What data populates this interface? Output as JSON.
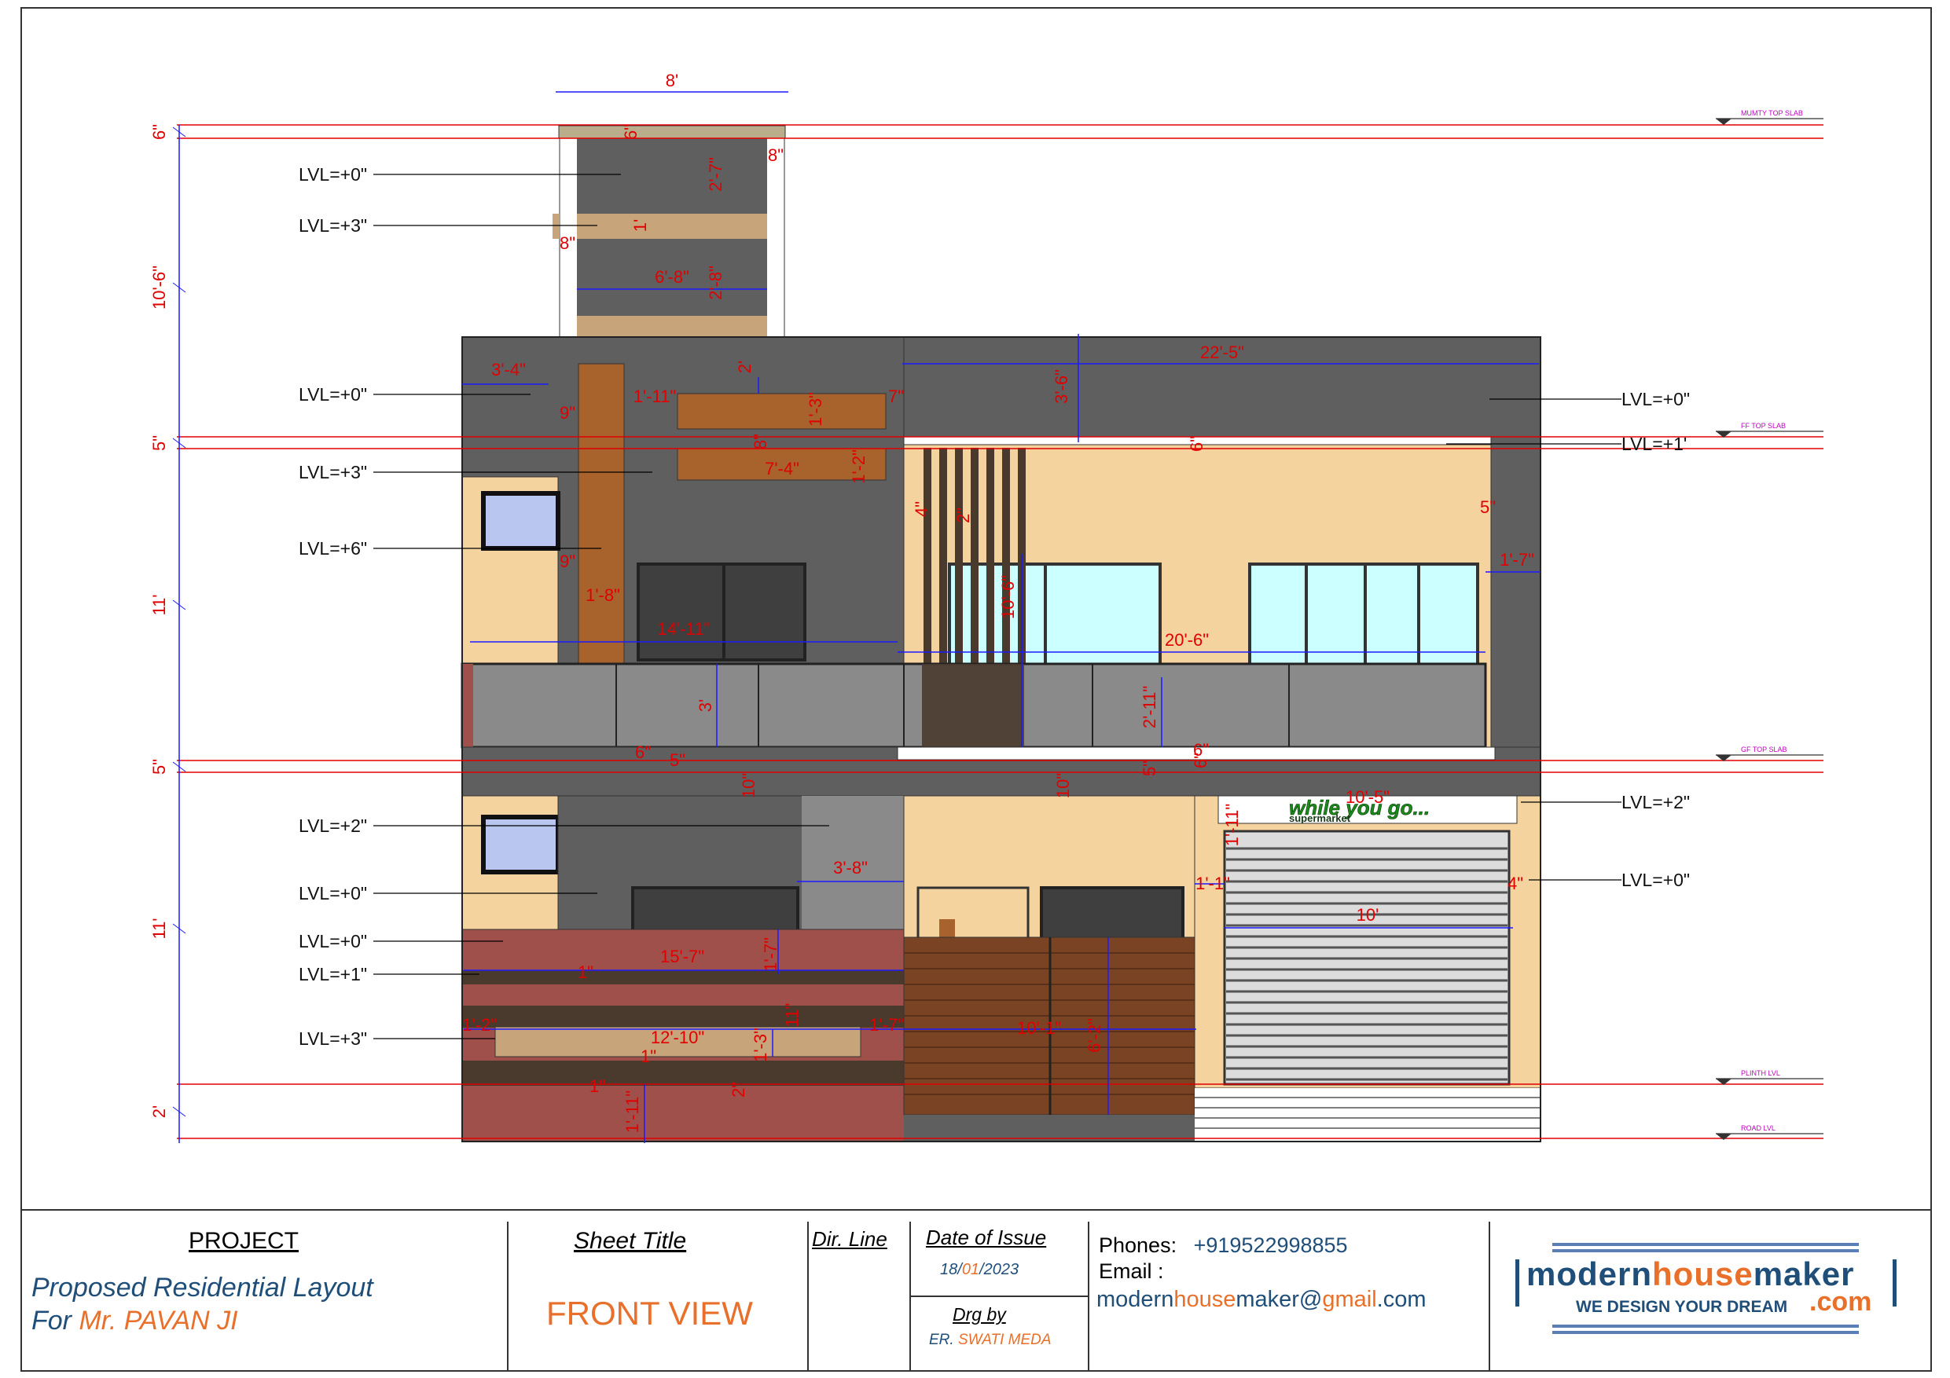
{
  "levels": {
    "right_ticks": [
      "MUMTY TOP SLAB",
      "FF TOP SLAB",
      "GF TOP SLAB",
      "PLINTH LVL",
      "ROAD LVL"
    ]
  },
  "left_callouts": [
    "LVL=+0\"",
    "LVL=+3\"",
    "LVL=+0\"",
    "LVL=+3\"",
    "LVL=+6\"",
    "LVL=+2\"",
    "LVL=+0\"",
    "LVL=+0\"",
    "LVL=+1\"",
    "LVL=+3\""
  ],
  "right_callouts": [
    "LVL=+0\"",
    "LVL=+1'",
    "LVL=+2\"",
    "LVL=+0\""
  ],
  "vertical_dims": [
    "6\"",
    "10'-6\"",
    "5\"",
    "11'",
    "5\"",
    "11'",
    "2'"
  ],
  "mumty_dims": [
    "8'",
    "6\"",
    "2'-7\"",
    "8\"",
    "1'",
    "8\"",
    "6'-8\"",
    "2'-8\""
  ],
  "ff_dims": [
    "3'-4\"",
    "9\"",
    "1'-11\"",
    "7\"",
    "2'",
    "1'-3\"",
    "8\"",
    "7'-4\"",
    "1'-2\"",
    "9\"",
    "1'-8\"",
    "14'-11\"",
    "3'",
    "6\"",
    "5\"",
    "22'-5\"",
    "3'-6\"",
    "6\"",
    "5\"",
    "1'-7\"",
    "4\"",
    "2\"",
    "10'-6\"",
    "20'-6\"",
    "2'-11\"",
    "6\"",
    "6\""
  ],
  "gf_dims": [
    "10\"",
    "10\"",
    "5\"",
    "3'-8\"",
    "1'-11\"",
    "10'-5\"",
    "1'-1\"",
    "4\"",
    "10'",
    "15'-7\"",
    "1'-7\"",
    "1\"",
    "1'-2\"",
    "12'-10\"",
    "1'-3\"",
    "11\"",
    "1'-7\"",
    "10'-1\"",
    "6'-2\"",
    "1\"",
    "1\"",
    "2\"",
    "1'-11\""
  ],
  "shop_sign": {
    "main": "while you go...",
    "sub": "supermarket"
  },
  "title_block": {
    "project_label": "PROJECT",
    "project_line1": "Proposed Residential Layout",
    "project_for": "For",
    "client": "Mr. PAVAN JI",
    "sheet_title_label": "Sheet Title",
    "sheet_title": "FRONT VIEW",
    "dir_line_label": "Dir. Line",
    "date_label": "Date of Issue",
    "date_day": "18/",
    "date_month": "01",
    "date_year": "/2023",
    "drawn_by_label": "Drg by",
    "drawn_by_prefix": "ER.",
    "drawn_by_name": "SWATI MEDA",
    "phones_label": "Phones:",
    "phone": "+919522998855",
    "email_label": "Email :",
    "email_part1": "modern",
    "email_part2": "house",
    "email_part3": "maker@",
    "email_part4": "gmail",
    "email_part5": ".com",
    "logo_modern": "modern",
    "logo_house": "house",
    "logo_maker": "maker",
    "logo_tagline": "WE DESIGN YOUR DREAM",
    "logo_com": ".com"
  },
  "colors": {
    "dim_red": "#e00000",
    "dim_blue": "#1a1aff",
    "dark_grey": "#5f5f5f",
    "mid_grey": "#8a8a8a",
    "beige": "#f5d39e",
    "brick": "#a0504a",
    "wood": "#a8632d",
    "glass": "#ccffff",
    "tan": "#c8a47a",
    "brand_blue": "#1f4e79",
    "brand_orange": "#e8702a"
  }
}
